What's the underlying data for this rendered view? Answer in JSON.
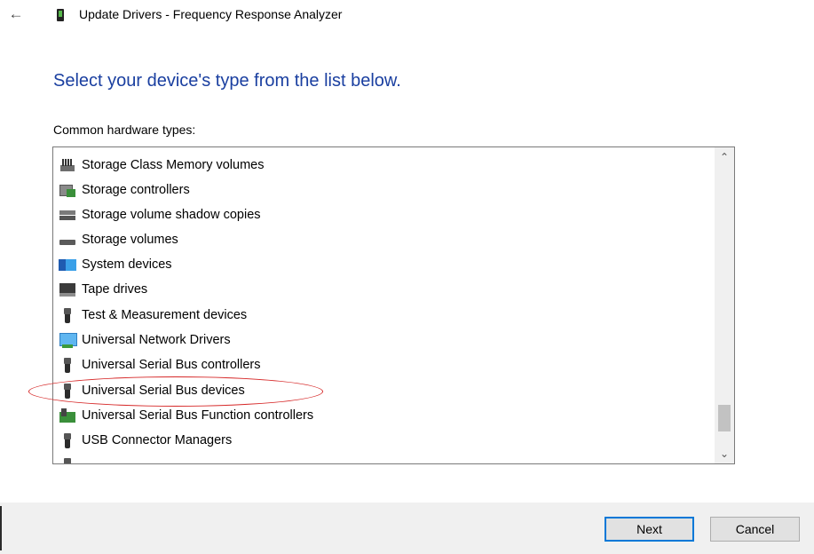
{
  "window": {
    "title": "Update Drivers - Frequency Response Analyzer"
  },
  "icons": {
    "back": "back-arrow-icon",
    "device": "device-icon"
  },
  "heading": "Select your device's type from the list below.",
  "list_label": "Common hardware types:",
  "hardware_types": [
    {
      "label": "Storage Class Memory volumes",
      "icon": "storage-class-memory-icon"
    },
    {
      "label": "Storage controllers",
      "icon": "storage-controller-icon"
    },
    {
      "label": "Storage volume shadow copies",
      "icon": "shadow-copy-icon"
    },
    {
      "label": "Storage volumes",
      "icon": "storage-volume-icon"
    },
    {
      "label": "System devices",
      "icon": "system-devices-icon"
    },
    {
      "label": "Tape drives",
      "icon": "tape-drive-icon"
    },
    {
      "label": "Test & Measurement devices",
      "icon": "usb-plug-icon"
    },
    {
      "label": "Universal Network Drivers",
      "icon": "network-drivers-icon"
    },
    {
      "label": "Universal Serial Bus controllers",
      "icon": "usb-plug-icon"
    },
    {
      "label": "Universal Serial Bus devices",
      "icon": "usb-plug-icon",
      "highlighted": true
    },
    {
      "label": "Universal Serial Bus Function controllers",
      "icon": "usb-function-icon"
    },
    {
      "label": "USB Connector Managers",
      "icon": "usb-plug-icon"
    }
  ],
  "buttons": {
    "next": "Next",
    "cancel": "Cancel"
  },
  "colors": {
    "heading": "#1a3fa0",
    "annotation": "#d62828",
    "default_button_border": "#0078d7"
  }
}
